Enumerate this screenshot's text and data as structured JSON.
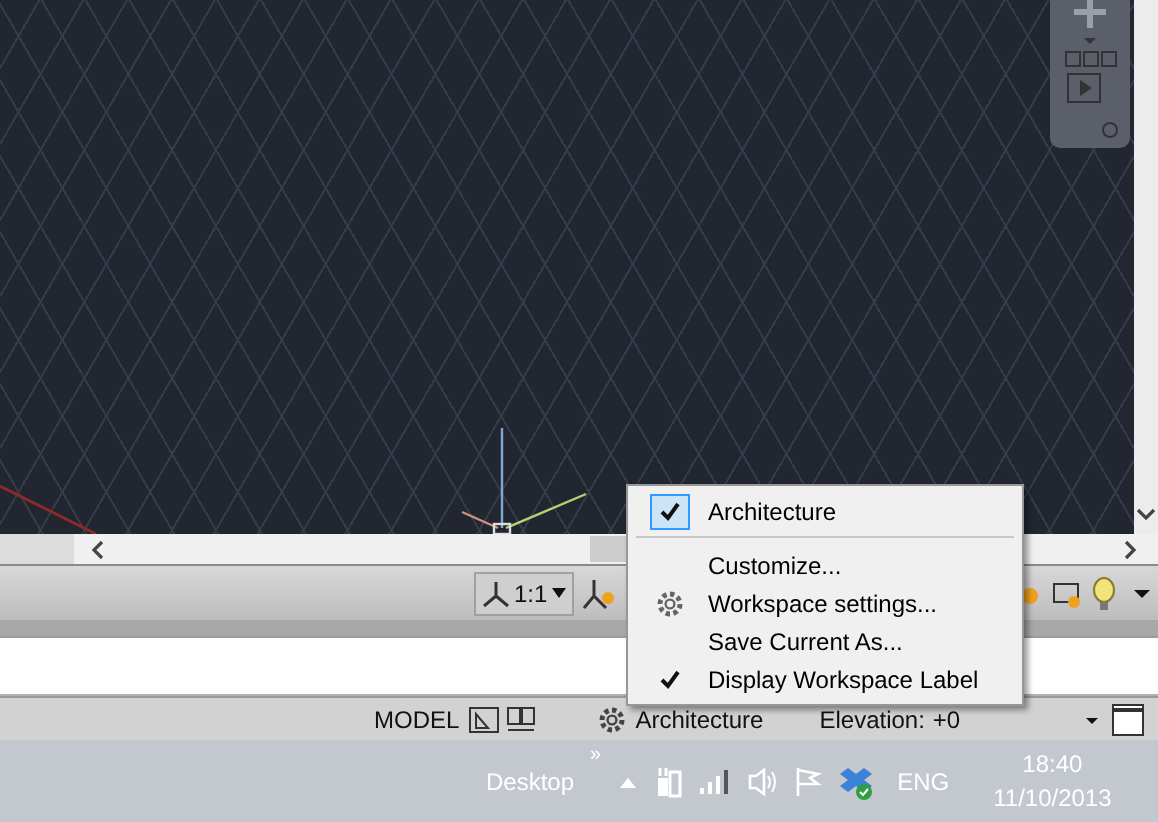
{
  "annotation_scale": {
    "value": "1:1"
  },
  "status_bar": {
    "model": "MODEL",
    "workspace": "Architecture",
    "elevation_label": "Elevation:",
    "elevation_value": "+0"
  },
  "workspace_menu": {
    "items": [
      {
        "kind": "workspace",
        "label": "Architecture",
        "checked": true
      },
      {
        "kind": "separator"
      },
      {
        "kind": "command",
        "label": "Customize..."
      },
      {
        "kind": "settings",
        "label": "Workspace settings..."
      },
      {
        "kind": "command",
        "label": "Save Current As..."
      },
      {
        "kind": "toggle",
        "label": "Display Workspace Label",
        "checked": true
      }
    ]
  },
  "taskbar": {
    "toolbar": "Desktop",
    "overflow": "»",
    "language": "ENG",
    "time": "18:40",
    "date": "11/10/2013"
  }
}
